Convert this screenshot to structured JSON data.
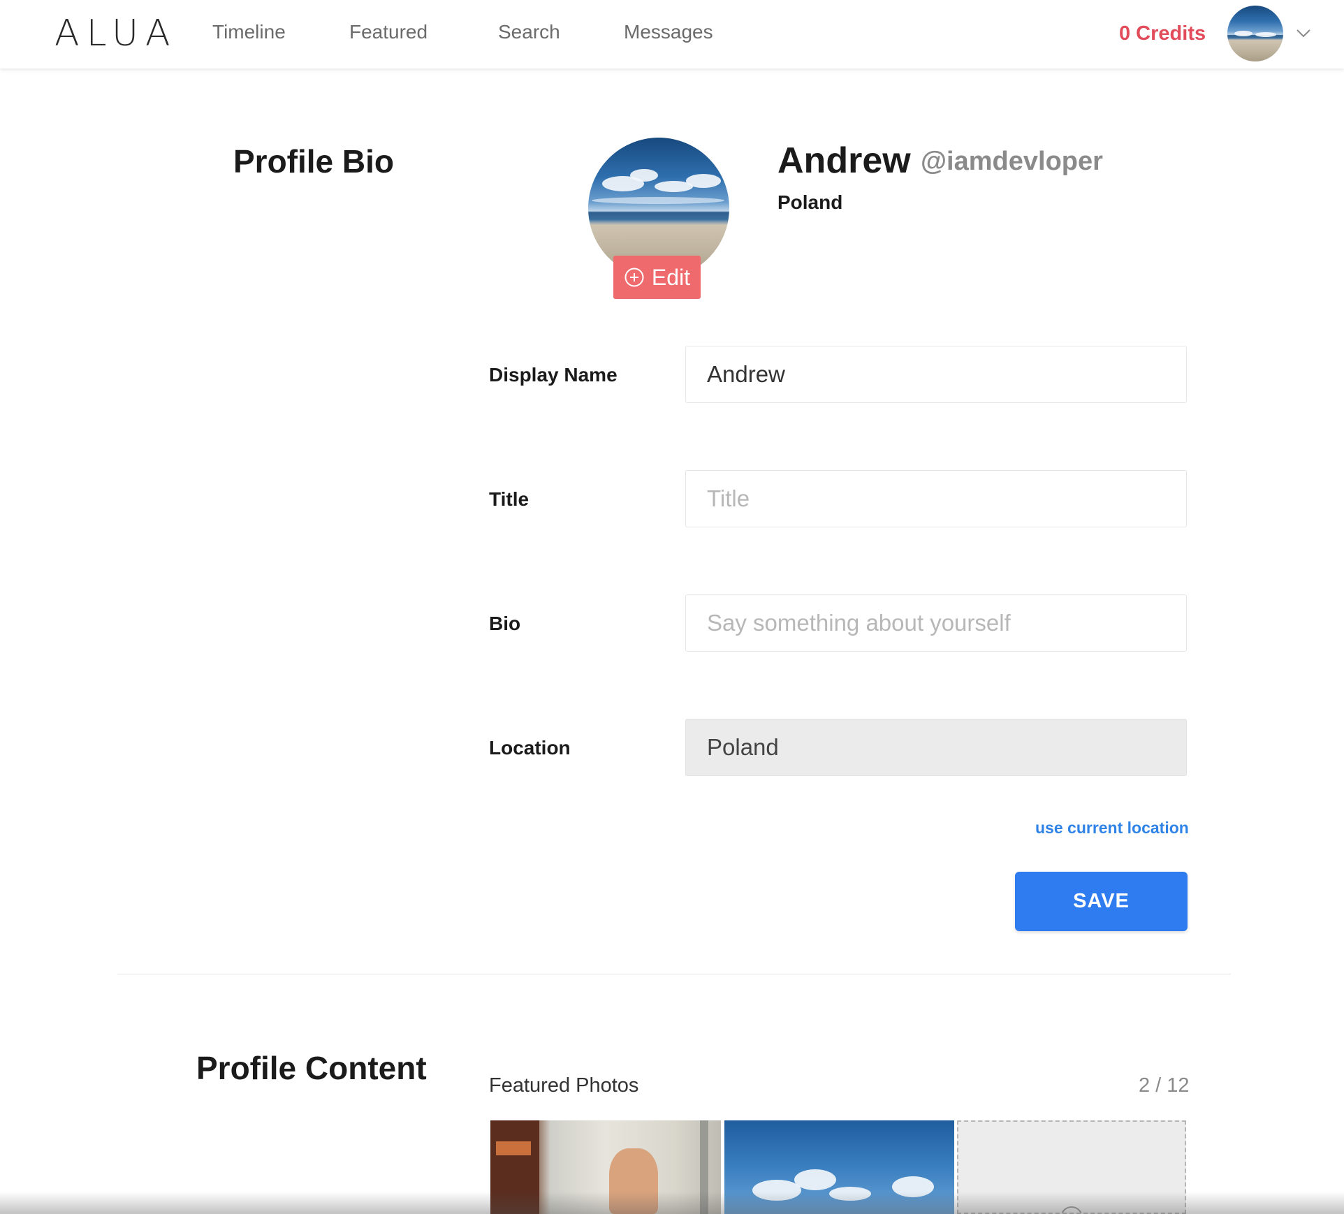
{
  "brand": {
    "logo_text": "ALUA"
  },
  "nav": {
    "links": [
      "Timeline",
      "Featured",
      "Search",
      "Messages"
    ],
    "credits": "0 Credits"
  },
  "colors": {
    "accent_red": "#e14b5a",
    "edit_button": "#ee6a6d",
    "primary_blue": "#2f7cf1",
    "link_blue": "#2f82e6"
  },
  "profile_bio": {
    "section_title": "Profile Bio",
    "name": "Andrew",
    "handle": "@iamdevloper",
    "country": "Poland",
    "edit_label": "Edit",
    "edit_icon": "plus-circle-icon"
  },
  "form": {
    "display_name": {
      "label": "Display Name",
      "value": "Andrew"
    },
    "title": {
      "label": "Title",
      "placeholder": "Title"
    },
    "bio": {
      "label": "Bio",
      "placeholder": "Say something about yourself"
    },
    "location": {
      "label": "Location",
      "value": "Poland"
    },
    "use_location": "use current location",
    "save": "SAVE"
  },
  "profile_content": {
    "section_title": "Profile Content",
    "featured_label": "Featured Photos",
    "featured_count": "2 / 12"
  }
}
